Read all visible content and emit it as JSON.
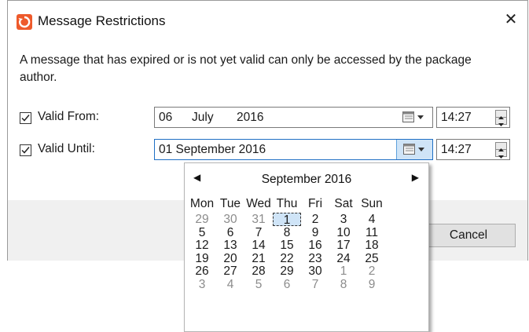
{
  "dialog": {
    "title": "Message Restrictions",
    "close_label": "✕",
    "description": "A message that has expired or is not yet valid can only be accessed by the package author.",
    "valid_from": {
      "label": "Valid From:",
      "checked": true,
      "day": "06",
      "month": "July",
      "year": "2016",
      "time": "14:27"
    },
    "valid_until": {
      "label": "Valid Until:",
      "checked": true,
      "date": "01 September 2016",
      "time": "14:27"
    },
    "cancel_label": "Cancel"
  },
  "calendar": {
    "title": "September 2016",
    "prev_label": "◀",
    "next_label": "▶",
    "weekdays": [
      "Mon",
      "Tue",
      "Wed",
      "Thu",
      "Fri",
      "Sat",
      "Sun"
    ],
    "weeks": [
      [
        "29",
        "30",
        "31",
        "1",
        "2",
        "3",
        "4"
      ],
      [
        "5",
        "6",
        "7",
        "8",
        "9",
        "10",
        "11"
      ],
      [
        "12",
        "13",
        "14",
        "15",
        "16",
        "17",
        "18"
      ],
      [
        "19",
        "20",
        "21",
        "22",
        "23",
        "24",
        "25"
      ],
      [
        "26",
        "27",
        "28",
        "29",
        "30",
        "1",
        "2"
      ],
      [
        "3",
        "4",
        "5",
        "6",
        "7",
        "8",
        "9"
      ]
    ],
    "selected_day": "1"
  },
  "colors": {
    "accent": "#1f6fc4",
    "selection": "#cfe4f7",
    "app_icon": "#ee5a2b",
    "footer": "#f0f0f0"
  },
  "icons": [
    "app-logo-icon",
    "close-icon",
    "checkbox-check-icon",
    "calendar-icon",
    "spinner-up-icon",
    "spinner-down-icon"
  ]
}
